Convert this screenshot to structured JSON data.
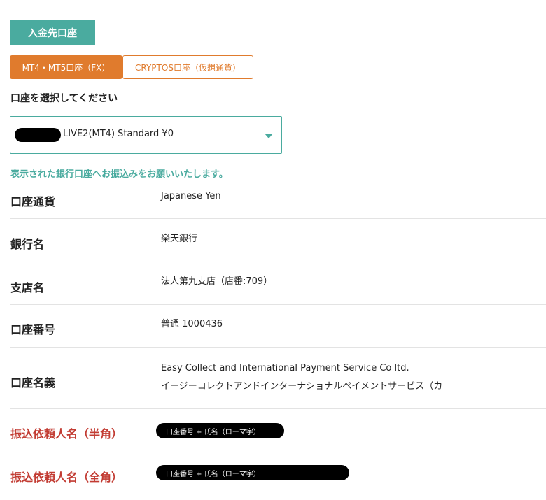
{
  "section_title": "入金先口座",
  "tabs": [
    {
      "label": "MT4・MT5口座（FX）",
      "active": true
    },
    {
      "label": "CRYPTOS口座（仮想通貨）",
      "active": false
    }
  ],
  "account_select": {
    "label": "口座を選択してください",
    "selected_value": "LIVE2(MT4) Standard ¥0",
    "icon": "chevron-down-icon"
  },
  "notice": "表示された銀行口座へお振込みをお願いいたします。",
  "bank_info": [
    {
      "label": "口座通貨",
      "value": "Japanese Yen"
    },
    {
      "label": "銀行名",
      "value": "楽天銀行"
    },
    {
      "label": "支店名",
      "value": "法人第九支店（店番:709）"
    },
    {
      "label": "口座番号",
      "value": "普通 1000436"
    },
    {
      "label": "口座名義",
      "value_lines": [
        "Easy Collect and International Payment Service Co ltd.",
        "イージーコレクトアンドインターナショナルペイメントサービス（カ"
      ]
    }
  ],
  "remitter": [
    {
      "label": "振込依頼人名（半角）",
      "value": "口座番号 + 氏名（ローマ字）"
    },
    {
      "label": "振込依頼人名（全角）",
      "value": "口座番号 + 氏名（ローマ字）"
    }
  ],
  "colors": {
    "teal": "#4aab9f",
    "orange": "#e07b2d",
    "red": "#c23b32",
    "divider": "#e3e3e3"
  }
}
